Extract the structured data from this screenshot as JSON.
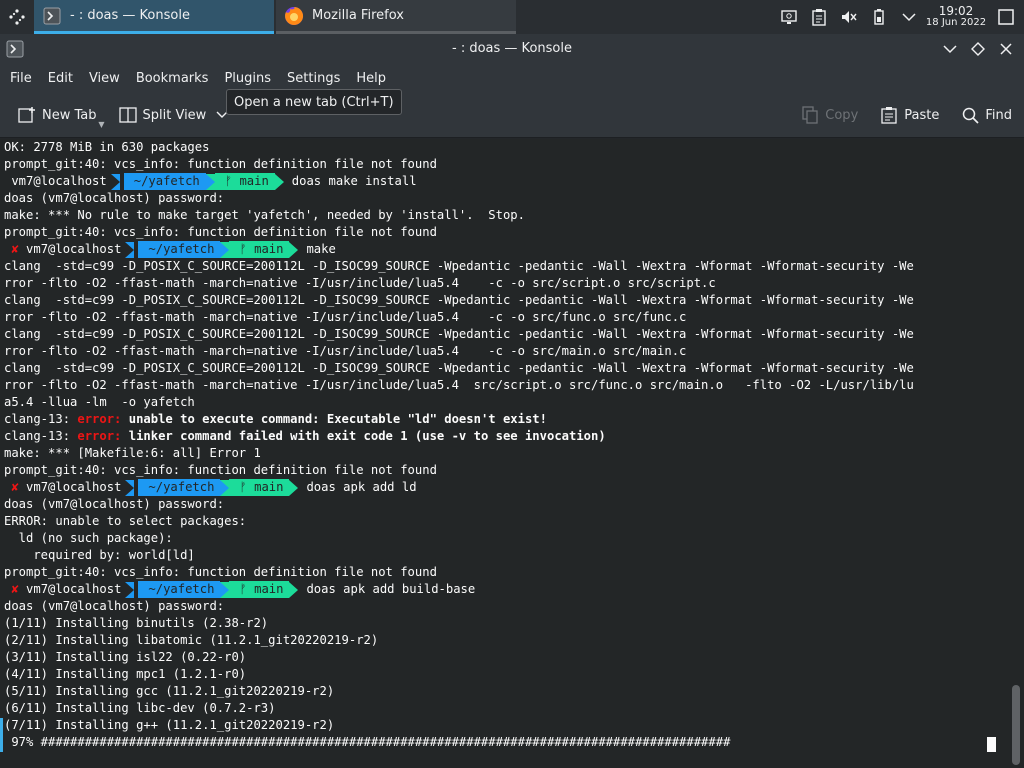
{
  "taskbar": {
    "tasks": [
      {
        "label": "- : doas — Konsole",
        "active": true
      },
      {
        "label": "Mozilla Firefox",
        "active": false
      }
    ],
    "clock": {
      "time": "19:02",
      "date": "18 Jun 2022"
    }
  },
  "window": {
    "title": "- : doas — Konsole"
  },
  "menu": {
    "items": [
      "File",
      "Edit",
      "View",
      "Bookmarks",
      "Plugins",
      "Settings",
      "Help"
    ]
  },
  "toolbar": {
    "new_tab": "New Tab",
    "split_view": "Split View",
    "copy": "Copy",
    "paste": "Paste",
    "find": "Find"
  },
  "tooltip": {
    "text": "Open a new tab (Ctrl+T)"
  },
  "prompt": {
    "user_host": "vm7@localhost",
    "dir": "~/yafetch",
    "branch_icon": "ᚠ",
    "branch": "main",
    "fail_mark": "✘"
  },
  "terminal": {
    "lines": [
      {
        "type": "text",
        "text": "OK: 2778 MiB in 630 packages"
      },
      {
        "type": "text",
        "text": "prompt_git:40: vcs_info: function definition file not found"
      },
      {
        "type": "prompt",
        "fail": false,
        "cmd": "doas make install"
      },
      {
        "type": "text",
        "text": "doas (vm7@localhost) password:"
      },
      {
        "type": "text",
        "text": "make: *** No rule to make target 'yafetch', needed by 'install'.  Stop."
      },
      {
        "type": "text",
        "text": "prompt_git:40: vcs_info: function definition file not found"
      },
      {
        "type": "prompt",
        "fail": true,
        "cmd": "make"
      },
      {
        "type": "text",
        "text": "clang  -std=c99 -D_POSIX_C_SOURCE=200112L -D_ISOC99_SOURCE -Wpedantic -pedantic -Wall -Wextra -Wformat -Wformat-security -We"
      },
      {
        "type": "text",
        "text": "rror -flto -O2 -ffast-math -march=native -I/usr/include/lua5.4    -c -o src/script.o src/script.c"
      },
      {
        "type": "text",
        "text": "clang  -std=c99 -D_POSIX_C_SOURCE=200112L -D_ISOC99_SOURCE -Wpedantic -pedantic -Wall -Wextra -Wformat -Wformat-security -We"
      },
      {
        "type": "text",
        "text": "rror -flto -O2 -ffast-math -march=native -I/usr/include/lua5.4    -c -o src/func.o src/func.c"
      },
      {
        "type": "text",
        "text": "clang  -std=c99 -D_POSIX_C_SOURCE=200112L -D_ISOC99_SOURCE -Wpedantic -pedantic -Wall -Wextra -Wformat -Wformat-security -We"
      },
      {
        "type": "text",
        "text": "rror -flto -O2 -ffast-math -march=native -I/usr/include/lua5.4    -c -o src/main.o src/main.c"
      },
      {
        "type": "text",
        "text": "clang  -std=c99 -D_POSIX_C_SOURCE=200112L -D_ISOC99_SOURCE -Wpedantic -pedantic -Wall -Wextra -Wformat -Wformat-security -We"
      },
      {
        "type": "text",
        "text": "rror -flto -O2 -ffast-math -march=native -I/usr/include/lua5.4  src/script.o src/func.o src/main.o   -flto -O2 -L/usr/lib/lu"
      },
      {
        "type": "text",
        "text": "a5.4 -llua -lm  -o yafetch"
      },
      {
        "type": "error",
        "prefix": "clang-13: ",
        "label": "error:",
        "msg": " unable to execute command: Executable \"ld\" doesn't exist!"
      },
      {
        "type": "error",
        "prefix": "clang-13: ",
        "label": "error:",
        "msg": " linker command failed with exit code 1 (use -v to see invocation)"
      },
      {
        "type": "text",
        "text": "make: *** [Makefile:6: all] Error 1"
      },
      {
        "type": "text",
        "text": "prompt_git:40: vcs_info: function definition file not found"
      },
      {
        "type": "prompt",
        "fail": true,
        "cmd": "doas apk add ld"
      },
      {
        "type": "text",
        "text": "doas (vm7@localhost) password:"
      },
      {
        "type": "text",
        "text": "ERROR: unable to select packages:"
      },
      {
        "type": "text",
        "text": "  ld (no such package):"
      },
      {
        "type": "text",
        "text": "    required by: world[ld]"
      },
      {
        "type": "text",
        "text": "prompt_git:40: vcs_info: function definition file not found"
      },
      {
        "type": "prompt",
        "fail": true,
        "cmd": "doas apk add build-base"
      },
      {
        "type": "text",
        "text": "doas (vm7@localhost) password:"
      },
      {
        "type": "text",
        "text": "(1/11) Installing binutils (2.38-r2)"
      },
      {
        "type": "text",
        "text": "(2/11) Installing libatomic (11.2.1_git20220219-r2)"
      },
      {
        "type": "text",
        "text": "(3/11) Installing isl22 (0.22-r0)"
      },
      {
        "type": "text",
        "text": "(4/11) Installing mpc1 (1.2.1-r0)"
      },
      {
        "type": "text",
        "text": "(5/11) Installing gcc (11.2.1_git20220219-r2)"
      },
      {
        "type": "text",
        "text": "(6/11) Installing libc-dev (0.7.2-r3)"
      },
      {
        "type": "text",
        "text": "(7/11) Installing g++ (11.2.1_git20220219-r2)"
      },
      {
        "type": "text",
        "text": " 97% ##############################################################################################"
      }
    ]
  },
  "colors": {
    "accent": "#3daee9",
    "prompt_dir": "#1d99f3",
    "prompt_git": "#1cdc9a",
    "error": "#ed1515"
  }
}
